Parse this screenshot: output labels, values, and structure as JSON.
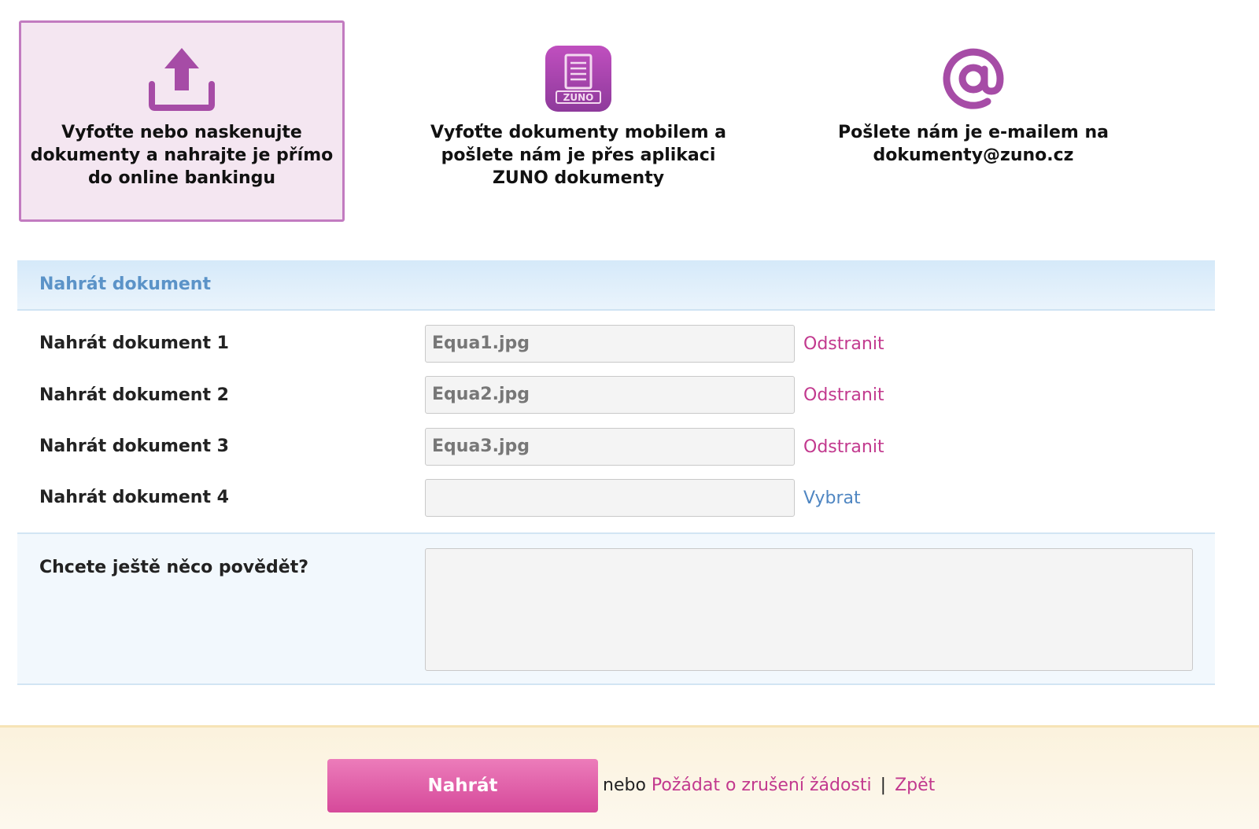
{
  "options": [
    {
      "text": "Vyfoťte nebo naskenujte dokumenty a nahrajte je přímo do online bankingu",
      "icon": "upload-icon",
      "active": true
    },
    {
      "text": "Vyfoťte dokumenty mobilem a pošlete nám je přes aplikaci ZUNO dokumenty",
      "icon": "zuno-app-icon",
      "app_badge": "ZUNO",
      "active": false
    },
    {
      "text": "Pošlete nám je e-mailem na dokumenty@zuno.cz",
      "icon": "at-sign-icon",
      "active": false
    }
  ],
  "upload": {
    "title": "Nahrát dokument",
    "rows": [
      {
        "label": "Nahrát dokument 1",
        "value": "Equa1.jpg",
        "action": "Odstranit"
      },
      {
        "label": "Nahrát dokument 2",
        "value": "Equa2.jpg",
        "action": "Odstranit"
      },
      {
        "label": "Nahrát dokument 3",
        "value": "Equa3.jpg",
        "action": "Odstranit"
      },
      {
        "label": "Nahrát dokument 4",
        "value": "",
        "action": "Vybrat"
      }
    ],
    "comment_label": "Chcete ještě něco povědět?",
    "comment_value": ""
  },
  "footer": {
    "submit_label": "Nahrát",
    "or_text": "nebo",
    "cancel_link": "Požádat o zrušení žádosti",
    "separator": "|",
    "back_link": "Zpět"
  },
  "colors": {
    "accent_pink": "#c2398e",
    "link_blue": "#4f86c2",
    "icon_purple": "#a64ca6"
  }
}
